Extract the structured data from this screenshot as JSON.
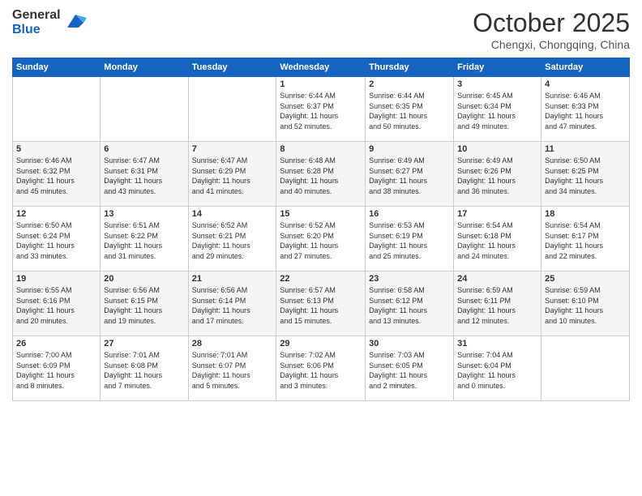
{
  "logo": {
    "general": "General",
    "blue": "Blue"
  },
  "header": {
    "month": "October 2025",
    "location": "Chengxi, Chongqing, China"
  },
  "weekdays": [
    "Sunday",
    "Monday",
    "Tuesday",
    "Wednesday",
    "Thursday",
    "Friday",
    "Saturday"
  ],
  "weeks": [
    [
      {
        "day": "",
        "info": ""
      },
      {
        "day": "",
        "info": ""
      },
      {
        "day": "",
        "info": ""
      },
      {
        "day": "1",
        "info": "Sunrise: 6:44 AM\nSunset: 6:37 PM\nDaylight: 11 hours\nand 52 minutes."
      },
      {
        "day": "2",
        "info": "Sunrise: 6:44 AM\nSunset: 6:35 PM\nDaylight: 11 hours\nand 50 minutes."
      },
      {
        "day": "3",
        "info": "Sunrise: 6:45 AM\nSunset: 6:34 PM\nDaylight: 11 hours\nand 49 minutes."
      },
      {
        "day": "4",
        "info": "Sunrise: 6:46 AM\nSunset: 6:33 PM\nDaylight: 11 hours\nand 47 minutes."
      }
    ],
    [
      {
        "day": "5",
        "info": "Sunrise: 6:46 AM\nSunset: 6:32 PM\nDaylight: 11 hours\nand 45 minutes."
      },
      {
        "day": "6",
        "info": "Sunrise: 6:47 AM\nSunset: 6:31 PM\nDaylight: 11 hours\nand 43 minutes."
      },
      {
        "day": "7",
        "info": "Sunrise: 6:47 AM\nSunset: 6:29 PM\nDaylight: 11 hours\nand 41 minutes."
      },
      {
        "day": "8",
        "info": "Sunrise: 6:48 AM\nSunset: 6:28 PM\nDaylight: 11 hours\nand 40 minutes."
      },
      {
        "day": "9",
        "info": "Sunrise: 6:49 AM\nSunset: 6:27 PM\nDaylight: 11 hours\nand 38 minutes."
      },
      {
        "day": "10",
        "info": "Sunrise: 6:49 AM\nSunset: 6:26 PM\nDaylight: 11 hours\nand 36 minutes."
      },
      {
        "day": "11",
        "info": "Sunrise: 6:50 AM\nSunset: 6:25 PM\nDaylight: 11 hours\nand 34 minutes."
      }
    ],
    [
      {
        "day": "12",
        "info": "Sunrise: 6:50 AM\nSunset: 6:24 PM\nDaylight: 11 hours\nand 33 minutes."
      },
      {
        "day": "13",
        "info": "Sunrise: 6:51 AM\nSunset: 6:22 PM\nDaylight: 11 hours\nand 31 minutes."
      },
      {
        "day": "14",
        "info": "Sunrise: 6:52 AM\nSunset: 6:21 PM\nDaylight: 11 hours\nand 29 minutes."
      },
      {
        "day": "15",
        "info": "Sunrise: 6:52 AM\nSunset: 6:20 PM\nDaylight: 11 hours\nand 27 minutes."
      },
      {
        "day": "16",
        "info": "Sunrise: 6:53 AM\nSunset: 6:19 PM\nDaylight: 11 hours\nand 25 minutes."
      },
      {
        "day": "17",
        "info": "Sunrise: 6:54 AM\nSunset: 6:18 PM\nDaylight: 11 hours\nand 24 minutes."
      },
      {
        "day": "18",
        "info": "Sunrise: 6:54 AM\nSunset: 6:17 PM\nDaylight: 11 hours\nand 22 minutes."
      }
    ],
    [
      {
        "day": "19",
        "info": "Sunrise: 6:55 AM\nSunset: 6:16 PM\nDaylight: 11 hours\nand 20 minutes."
      },
      {
        "day": "20",
        "info": "Sunrise: 6:56 AM\nSunset: 6:15 PM\nDaylight: 11 hours\nand 19 minutes."
      },
      {
        "day": "21",
        "info": "Sunrise: 6:56 AM\nSunset: 6:14 PM\nDaylight: 11 hours\nand 17 minutes."
      },
      {
        "day": "22",
        "info": "Sunrise: 6:57 AM\nSunset: 6:13 PM\nDaylight: 11 hours\nand 15 minutes."
      },
      {
        "day": "23",
        "info": "Sunrise: 6:58 AM\nSunset: 6:12 PM\nDaylight: 11 hours\nand 13 minutes."
      },
      {
        "day": "24",
        "info": "Sunrise: 6:59 AM\nSunset: 6:11 PM\nDaylight: 11 hours\nand 12 minutes."
      },
      {
        "day": "25",
        "info": "Sunrise: 6:59 AM\nSunset: 6:10 PM\nDaylight: 11 hours\nand 10 minutes."
      }
    ],
    [
      {
        "day": "26",
        "info": "Sunrise: 7:00 AM\nSunset: 6:09 PM\nDaylight: 11 hours\nand 8 minutes."
      },
      {
        "day": "27",
        "info": "Sunrise: 7:01 AM\nSunset: 6:08 PM\nDaylight: 11 hours\nand 7 minutes."
      },
      {
        "day": "28",
        "info": "Sunrise: 7:01 AM\nSunset: 6:07 PM\nDaylight: 11 hours\nand 5 minutes."
      },
      {
        "day": "29",
        "info": "Sunrise: 7:02 AM\nSunset: 6:06 PM\nDaylight: 11 hours\nand 3 minutes."
      },
      {
        "day": "30",
        "info": "Sunrise: 7:03 AM\nSunset: 6:05 PM\nDaylight: 11 hours\nand 2 minutes."
      },
      {
        "day": "31",
        "info": "Sunrise: 7:04 AM\nSunset: 6:04 PM\nDaylight: 11 hours\nand 0 minutes."
      },
      {
        "day": "",
        "info": ""
      }
    ]
  ]
}
